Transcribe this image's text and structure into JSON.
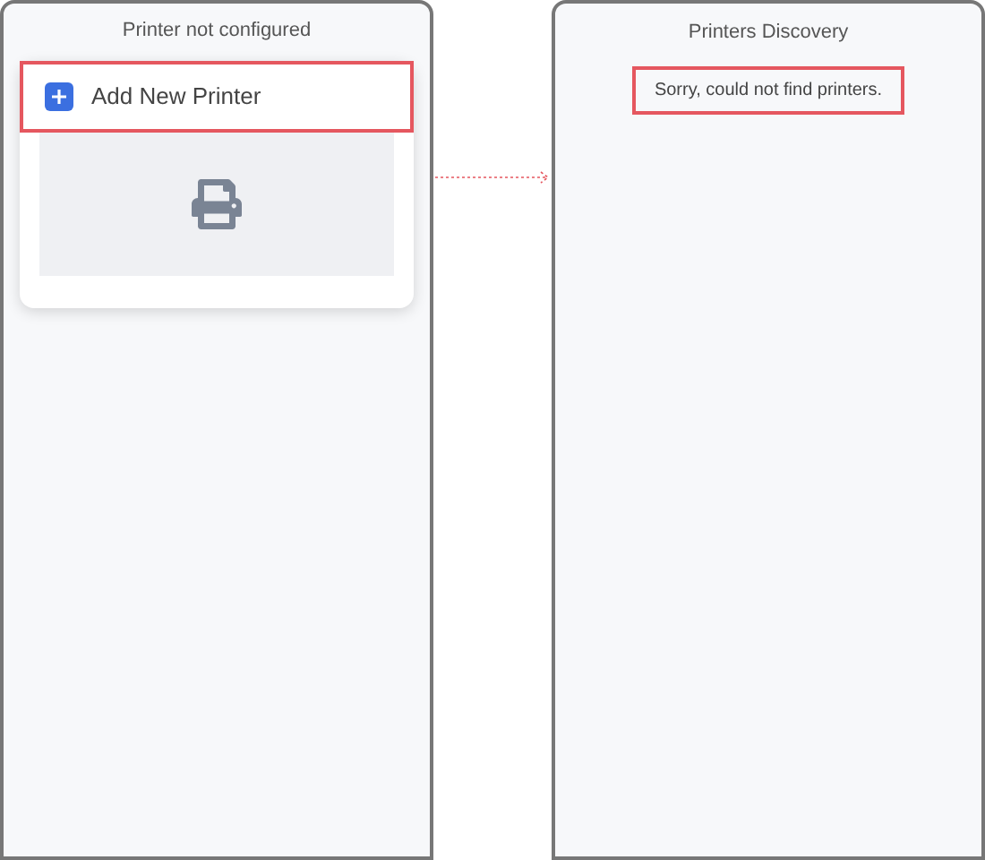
{
  "screens": [
    {
      "title": "Printer not configured",
      "add_button": {
        "label": "Add New Printer",
        "highlighted": true
      }
    },
    {
      "title": "Printers Discovery",
      "message": {
        "text": "Sorry, could not find printers.",
        "highlighted": true
      }
    }
  ]
}
